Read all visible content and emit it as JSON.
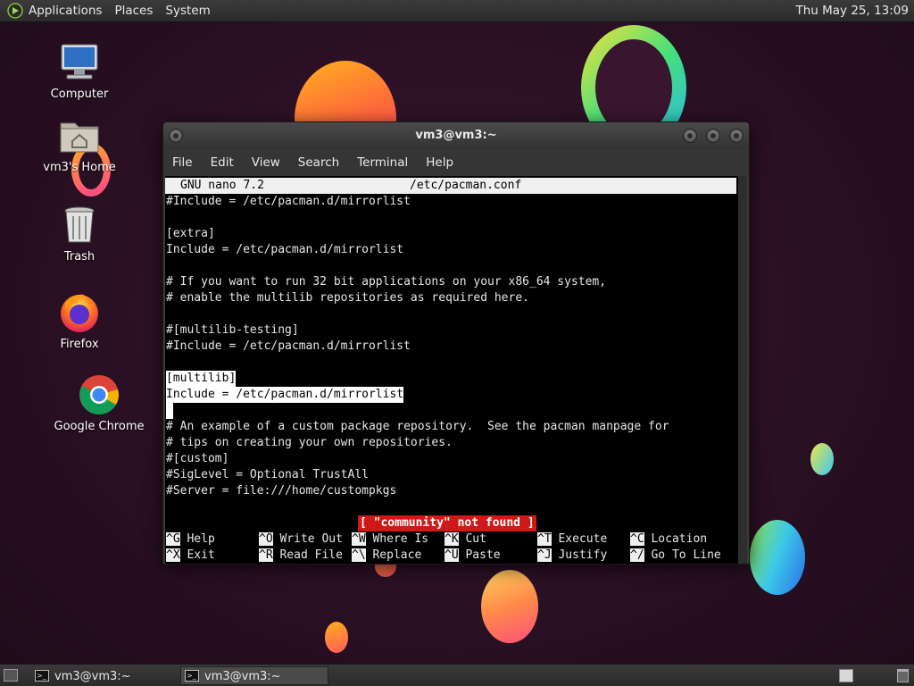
{
  "top_panel": {
    "menus": [
      "Applications",
      "Places",
      "System"
    ],
    "clock": "Thu May 25, 13:09"
  },
  "desktop_icons": [
    {
      "label": "Computer",
      "icon": "computer-icon"
    },
    {
      "label": "vm3's Home",
      "icon": "home-folder-icon"
    },
    {
      "label": "Trash",
      "icon": "trash-icon"
    },
    {
      "label": "Firefox",
      "icon": "firefox-icon"
    },
    {
      "label": "Google Chrome",
      "icon": "chrome-icon"
    }
  ],
  "window": {
    "title": "vm3@vm3:~",
    "menu": [
      "File",
      "Edit",
      "View",
      "Search",
      "Terminal",
      "Help"
    ]
  },
  "nano": {
    "version": "GNU nano 7.2",
    "filename": "/etc/pacman.conf",
    "lines": [
      "#Include = /etc/pacman.d/mirrorlist",
      "",
      "[extra]",
      "Include = /etc/pacman.d/mirrorlist",
      "",
      "# If you want to run 32 bit applications on your x86_64 system,",
      "# enable the multilib repositories as required here.",
      "",
      "#[multilib-testing]",
      "#Include = /etc/pacman.d/mirrorlist",
      "",
      "[multilib]",
      "Include = /etc/pacman.d/mirrorlist",
      "",
      "# An example of a custom package repository.  See the pacman manpage for",
      "# tips on creating your own repositories.",
      "#[custom]",
      "#SigLevel = Optional TrustAll",
      "#Server = file:///home/custompkgs"
    ],
    "status": "[ \"community\" not found ]",
    "shortcuts": [
      {
        "key": "^G",
        "label": "Help"
      },
      {
        "key": "^O",
        "label": "Write Out"
      },
      {
        "key": "^W",
        "label": "Where Is"
      },
      {
        "key": "^K",
        "label": "Cut"
      },
      {
        "key": "^T",
        "label": "Execute"
      },
      {
        "key": "^C",
        "label": "Location"
      },
      {
        "key": "^X",
        "label": "Exit"
      },
      {
        "key": "^R",
        "label": "Read File"
      },
      {
        "key": "^\\",
        "label": "Replace"
      },
      {
        "key": "^U",
        "label": "Paste"
      },
      {
        "key": "^J",
        "label": "Justify"
      },
      {
        "key": "^/",
        "label": "Go To Line"
      }
    ]
  },
  "taskbar": {
    "tasks": [
      "vm3@vm3:~",
      "vm3@vm3:~"
    ]
  }
}
